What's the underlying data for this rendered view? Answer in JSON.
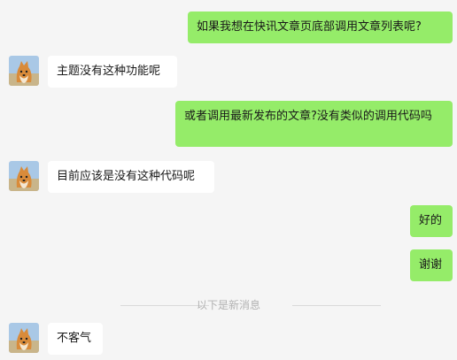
{
  "messages": [
    {
      "id": "m1",
      "from": "self",
      "text": "如果我想在快讯文章页底部调用文章列表呢?"
    },
    {
      "id": "m2",
      "from": "other",
      "text": "主题没有这种功能呢"
    },
    {
      "id": "m3",
      "from": "self",
      "text": "或者调用最新发布的文章?没有类似的调用代码吗"
    },
    {
      "id": "m4",
      "from": "other",
      "text": "目前应该是没有这种代码呢"
    },
    {
      "id": "m5",
      "from": "self",
      "text": "好的"
    },
    {
      "id": "m6",
      "from": "self",
      "text": "谢谢"
    },
    {
      "id": "m7",
      "from": "other",
      "text": "不客气"
    }
  ],
  "divider": {
    "label": "以下是新消息"
  },
  "colors": {
    "background": "#f5f5f5",
    "self_bubble": "#95ec69",
    "other_bubble": "#ffffff"
  },
  "icons": {
    "avatar": "shiba-dog-avatar-icon"
  }
}
